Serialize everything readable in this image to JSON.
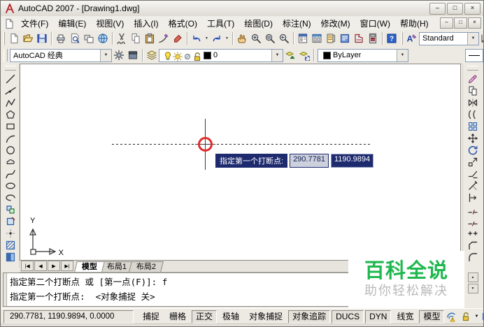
{
  "titlebar": {
    "title": "AutoCAD 2007 - [Drawing1.dwg]",
    "button_icons": [
      "minimize-icon",
      "maximize-icon",
      "close-icon"
    ]
  },
  "menubar": {
    "items": [
      {
        "key": "file",
        "label": "文件(F)"
      },
      {
        "key": "edit",
        "label": "编辑(E)"
      },
      {
        "key": "view",
        "label": "视图(V)"
      },
      {
        "key": "insert",
        "label": "插入(I)"
      },
      {
        "key": "format",
        "label": "格式(O)"
      },
      {
        "key": "tools",
        "label": "工具(T)"
      },
      {
        "key": "draw",
        "label": "绘图(D)"
      },
      {
        "key": "dimension",
        "label": "标注(N)"
      },
      {
        "key": "modify",
        "label": "修改(M)"
      },
      {
        "key": "window",
        "label": "窗口(W)"
      },
      {
        "key": "help",
        "label": "帮助(H)"
      }
    ],
    "mdi_button_icons": [
      "minimize-icon",
      "restore-icon",
      "close-icon"
    ]
  },
  "toolbar_row1": {
    "standard_groups": [
      [
        "qnew",
        "open",
        "save"
      ],
      [
        "plot",
        "plot-preview",
        "publish",
        "3d-dwf"
      ],
      [
        "cut",
        "copy",
        "paste",
        "match-properties",
        "block-editor"
      ],
      [
        "undo",
        "redo"
      ],
      [
        "pan",
        "zoom-realtime",
        "zoom-window",
        "zoom-previous"
      ],
      [
        "properties",
        "design-center",
        "tool-palettes",
        "sheet-set-manager",
        "markup-set-manager",
        "quick-calc"
      ],
      [
        "help"
      ]
    ],
    "styles": {
      "icon": "text-style",
      "value": "Standard"
    }
  },
  "toolbar_row2": {
    "workspace_value": "AutoCAD 经典",
    "workspace_icons": [
      "workspace-settings",
      "my-workspace"
    ],
    "layers_icon": "layer-properties",
    "layer_state_icons": [
      "layer-on",
      "layer-thaw",
      "layer-vpfreeze",
      "layer-unlock"
    ],
    "layer_value": "0",
    "layer_after_icons": [
      "make-object-layer",
      "layer-previous"
    ],
    "color_value": "ByLayer",
    "color_swatch": "#000000"
  },
  "draw_toolbar_icons": [
    "line",
    "construction-line",
    "polyline",
    "polygon",
    "rectangle",
    "arc",
    "circle",
    "revision-cloud",
    "spline",
    "ellipse",
    "ellipse-arc",
    "insert-block",
    "make-block",
    "point",
    "hatch",
    "gradient"
  ],
  "modify_toolbar_icons": [
    "erase",
    "copy-mod",
    "mirror",
    "offset",
    "array",
    "move",
    "rotate",
    "scale",
    "stretch",
    "trim",
    "extend",
    "break-at-point",
    "break",
    "join",
    "chamfer",
    "fillet"
  ],
  "canvas": {
    "dynamic_input": {
      "prompt": "指定第一个打断点:",
      "x_value": "290.7781",
      "y_value": "1190.9894"
    },
    "ucs": {
      "x_label": "X",
      "y_label": "Y"
    }
  },
  "layout_tabs": {
    "nav_icons": [
      "first-tab-icon",
      "prev-tab-icon",
      "next-tab-icon",
      "last-tab-icon"
    ],
    "items": [
      {
        "key": "model",
        "label": "模型",
        "active": true
      },
      {
        "key": "layout1",
        "label": "布局1",
        "active": false
      },
      {
        "key": "layout2",
        "label": "布局2",
        "active": false
      }
    ]
  },
  "command_window": {
    "lines": [
      "指定第二个打断点 或 [第一点(F)]: f",
      "指定第一个打断点:  <对象捕捉 关>"
    ]
  },
  "statusbar": {
    "coordinates": "290.7781, 1190.9894, 0.0000",
    "toggles": [
      {
        "key": "snap",
        "label": "捕捉",
        "on": false
      },
      {
        "key": "grid",
        "label": "栅格",
        "on": false
      },
      {
        "key": "ortho",
        "label": "正交",
        "on": true
      },
      {
        "key": "polar",
        "label": "极轴",
        "on": false
      },
      {
        "key": "osnap",
        "label": "对象捕捉",
        "on": false
      },
      {
        "key": "otrack",
        "label": "对象追踪",
        "on": true
      },
      {
        "key": "ducs",
        "label": "DUCS",
        "on": true
      },
      {
        "key": "dyn",
        "label": "DYN",
        "on": true
      },
      {
        "key": "lwt",
        "label": "线宽",
        "on": false
      },
      {
        "key": "model",
        "label": "模型",
        "on": true
      }
    ],
    "right_icons": [
      "communication-center",
      "toolbar-lock",
      "status-flyout",
      "clean-screen"
    ]
  },
  "watermark": {
    "title": "百科全说",
    "subtitle": "助你轻松解决",
    "title_color": "#1fb84f",
    "subtitle_color": "#b9b9b9"
  },
  "colors": {
    "tooltip_bg": "#1e2a6e",
    "marker_red": "#e02b2b",
    "chrome": "#edeae4",
    "canvas_bg": "#ffffff"
  }
}
